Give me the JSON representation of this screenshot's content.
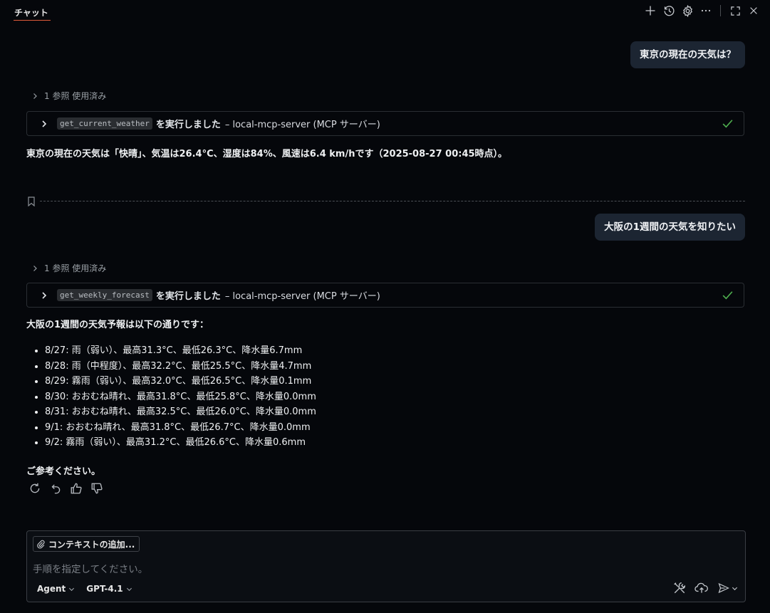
{
  "header": {
    "tab_title": "チャット",
    "icons": [
      "plus-icon",
      "history-icon",
      "gear-icon",
      "more-icon",
      "maximize-icon",
      "close-icon"
    ]
  },
  "messages": [
    {
      "user": "東京の現在の天気は？",
      "refs": "1 参照 使用済み",
      "tool_name": "get_current_weather",
      "tool_action": "を実行しました",
      "tool_server": "– local-mcp-server (MCP サーバー)",
      "answer": "東京の現在の天気は「快晴」、気温は26.4°C、湿度は84%、風速は6.4 km/hです（2025-08-27 00:45時点）。"
    },
    {
      "user": "大阪の1週間の天気を知りたい",
      "refs": "1 参照 使用済み",
      "tool_name": "get_weekly_forecast",
      "tool_action": "を実行しました",
      "tool_server": "– local-mcp-server (MCP サーバー)",
      "answer_intro": "大阪の1週間の天気予報は以下の通りです：",
      "forecast": [
        "8/27: 雨（弱い）、最高31.3°C、最低26.3°C、降水量6.7mm",
        "8/28: 雨（中程度）、最高32.2°C、最低25.5°C、降水量4.7mm",
        "8/29: 霧雨（弱い）、最高32.0°C、最低26.5°C、降水量0.1mm",
        "8/30: おおむね晴れ、最高31.8°C、最低25.8°C、降水量0.0mm",
        "8/31: おおむね晴れ、最高32.5°C、最低26.0°C、降水量0.0mm",
        "9/1: おおむね晴れ、最高31.8°C、最低26.7°C、降水量0.0mm",
        "9/2: 霧雨（弱い）、最高31.2°C、最低26.6°C、降水量0.6mm"
      ],
      "answer_outro": "ご参考ください。"
    }
  ],
  "input": {
    "context_button": "コンテキストの追加...",
    "placeholder": "手順を指定してください。",
    "mode": "Agent",
    "model": "GPT-4.1"
  },
  "colors": {
    "background": "#05070b",
    "bubble": "#1c2532",
    "check": "#4fb04f",
    "tab_accent": "#e05a3a"
  }
}
